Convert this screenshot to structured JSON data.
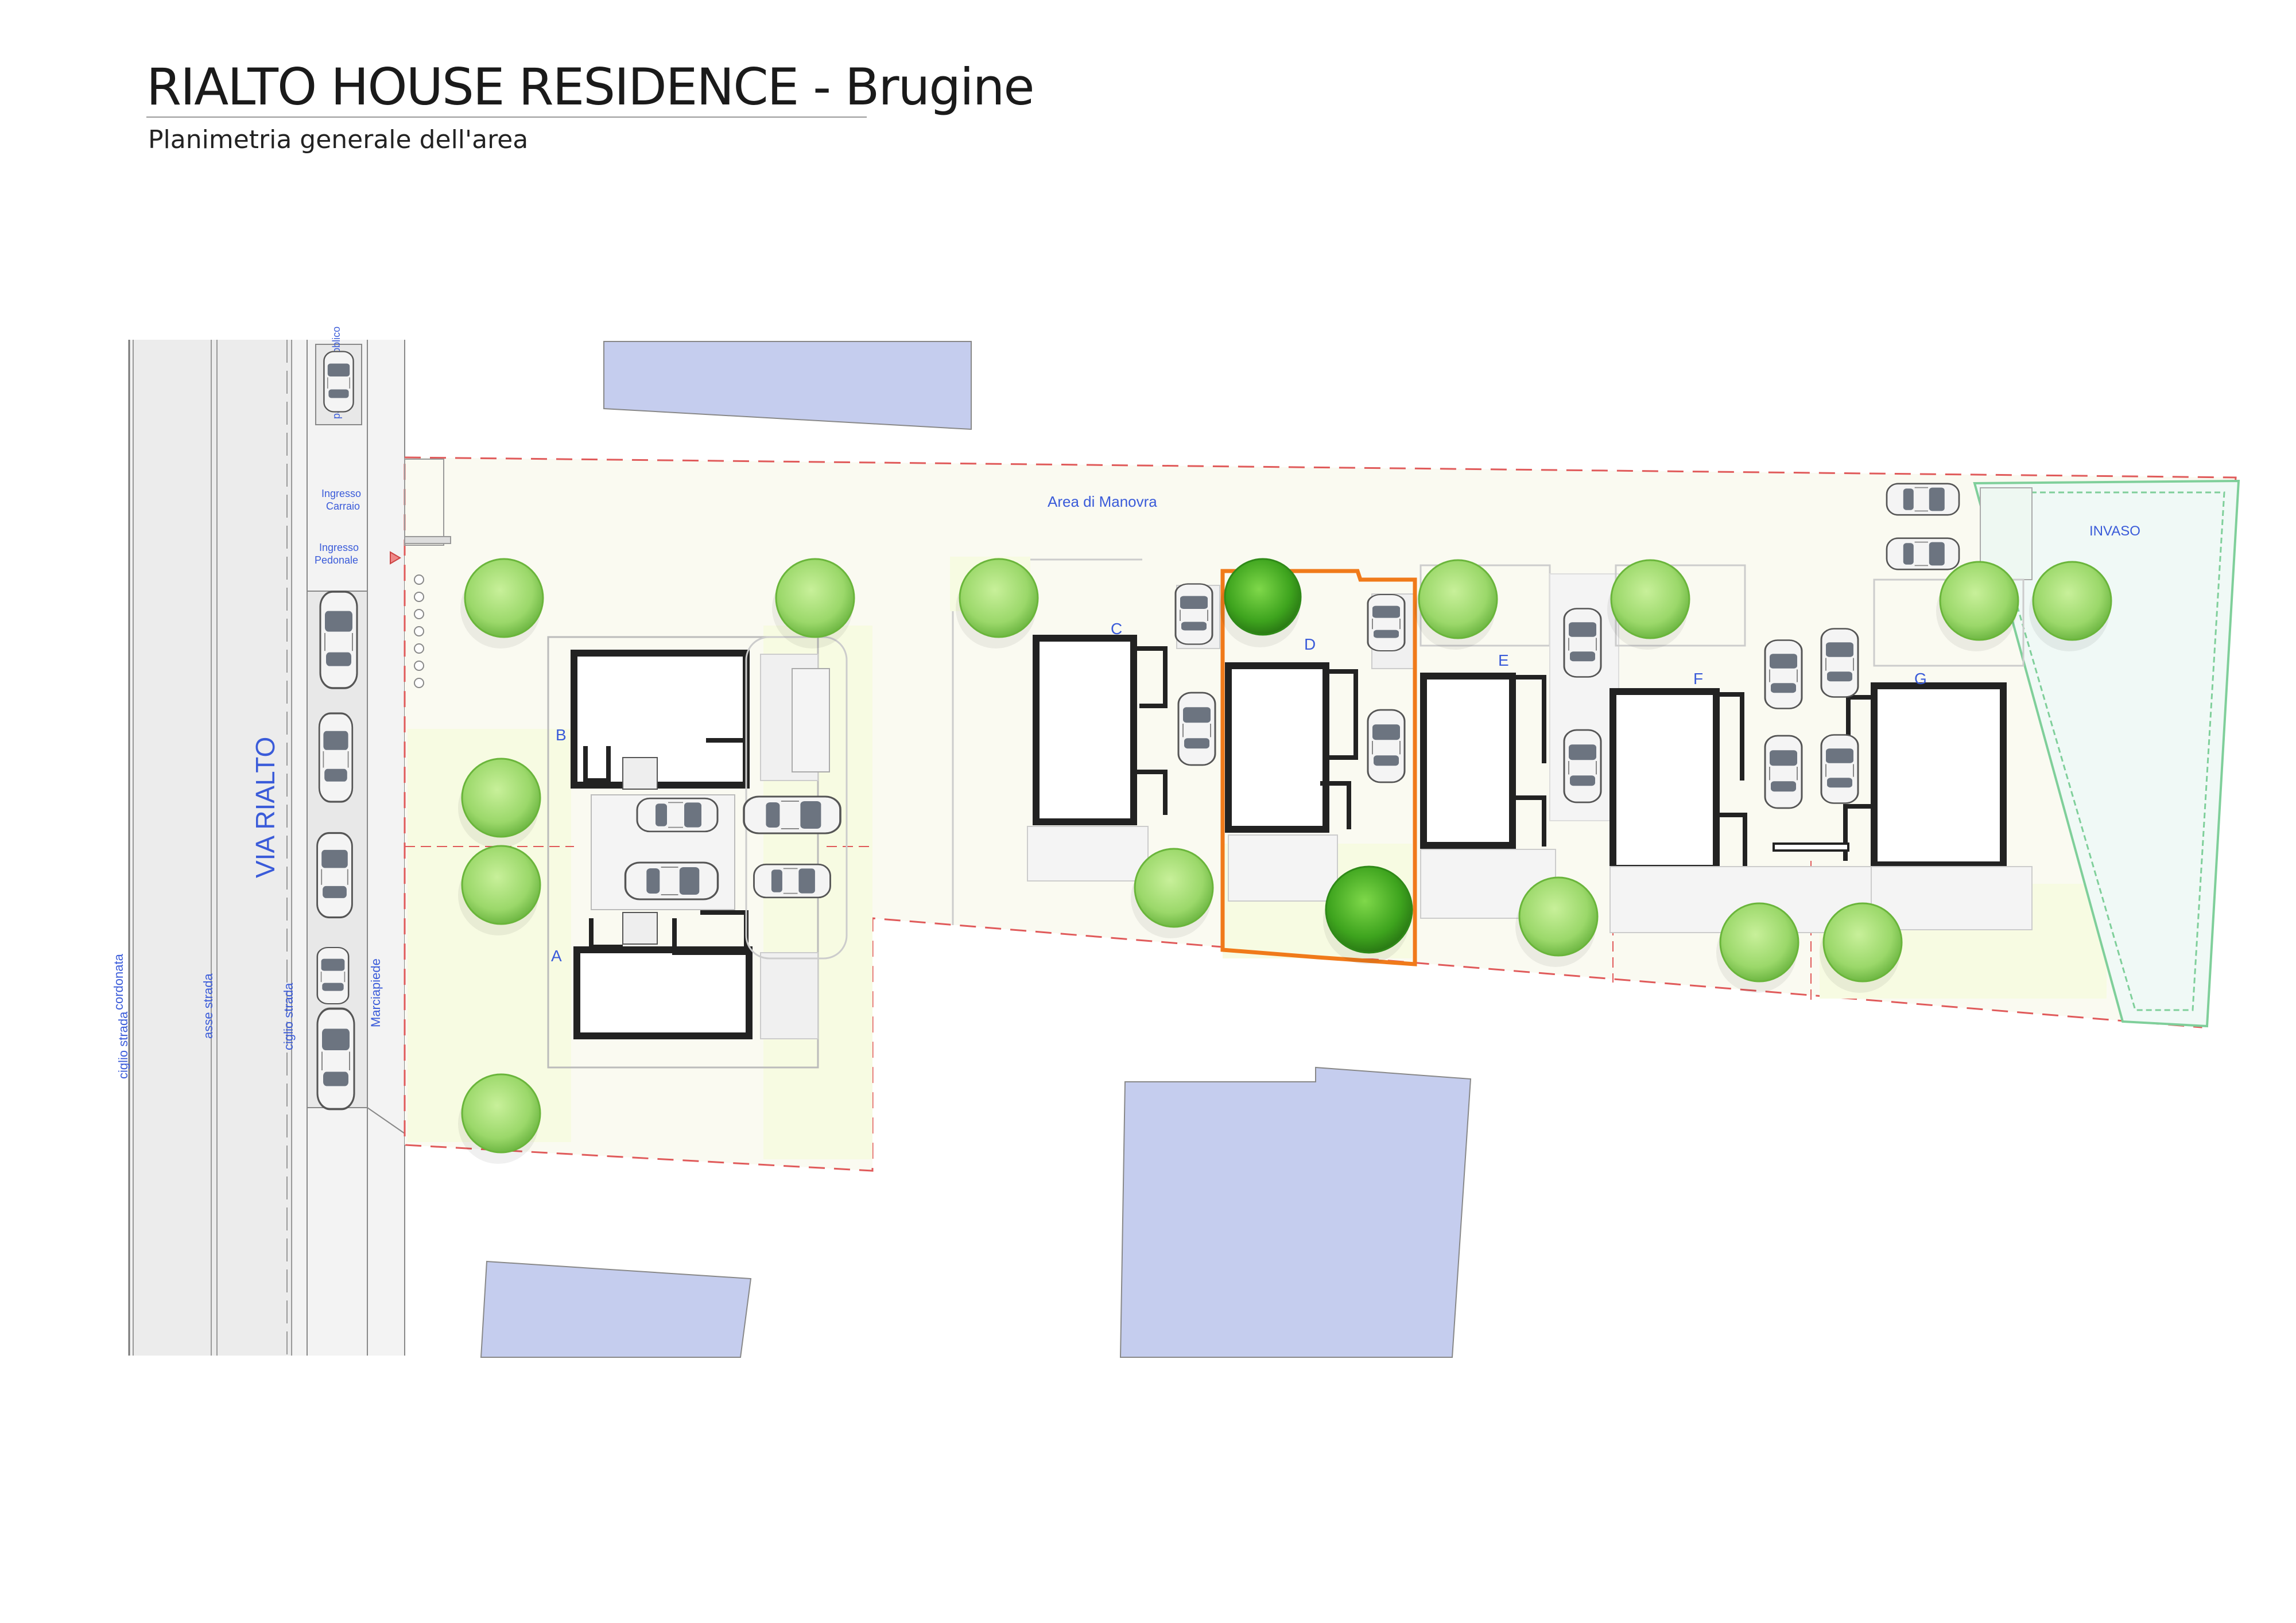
{
  "header": {
    "title": "RIALTO HOUSE RESIDENCE - Brugine",
    "subtitle": "Planimetria generale dell'area"
  },
  "street": {
    "name": "VIA RIALTO",
    "labels": {
      "cordonata": "cordonata",
      "ciglio_strada_left": "ciglio strada",
      "asse_strada": "asse strada",
      "ciglio_strada_right": "ciglio strada",
      "marciapiede": "Marciapiede",
      "parcheggio_pubblico": "parcheggio pubblico"
    }
  },
  "entrances": {
    "carraio": [
      "Ingresso",
      "Carraio"
    ],
    "pedonale": [
      "Ingresso",
      "Pedonale"
    ]
  },
  "areas": {
    "manovra": "Area di Manovra",
    "invaso": "INVASO"
  },
  "units": [
    "A",
    "B",
    "C",
    "D",
    "E",
    "F",
    "G"
  ],
  "colors": {
    "neighbor_building": "#c5cdee",
    "lot_boundary": "#e05a5a",
    "highlight": "#f07a1a",
    "tree_light": "#a6e07a",
    "tree_dark": "#4faa2a",
    "label_blue": "#3a5bd9",
    "invaso_green": "#7fcf9a"
  }
}
